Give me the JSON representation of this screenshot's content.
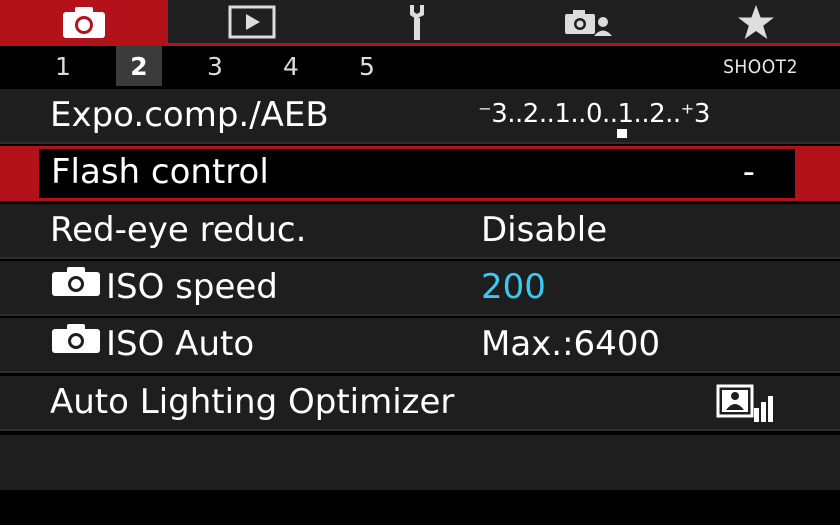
{
  "top_tabs": [
    {
      "icon": "camera-icon",
      "active": true
    },
    {
      "icon": "playback-icon",
      "active": false
    },
    {
      "icon": "wrench-icon",
      "active": false
    },
    {
      "icon": "custom-shooting-icon",
      "active": false
    },
    {
      "icon": "star-icon",
      "active": false
    }
  ],
  "sub_tabs": [
    "1",
    "2",
    "3",
    "4",
    "5"
  ],
  "active_sub_tab": "2",
  "page_label": "SHOOT2",
  "menu": {
    "expo": {
      "label": "Expo.comp./AEB",
      "value": "⁻3..2..1..0..1..2..⁺3",
      "value_ev": 0
    },
    "flash": {
      "label": "Flash control",
      "value": "-"
    },
    "redeye": {
      "label": "Red-eye reduc.",
      "value": "Disable"
    },
    "iso_speed": {
      "label": "ISO speed",
      "value": "200"
    },
    "iso_auto": {
      "label": "ISO Auto",
      "value": "Max.:6400"
    },
    "alo": {
      "label": "Auto Lighting Optimizer",
      "value_icon": "auto-lighting-optimizer-icon"
    }
  },
  "colors": {
    "accent": "#b3121b",
    "value_highlight": "#3cc8f0"
  }
}
